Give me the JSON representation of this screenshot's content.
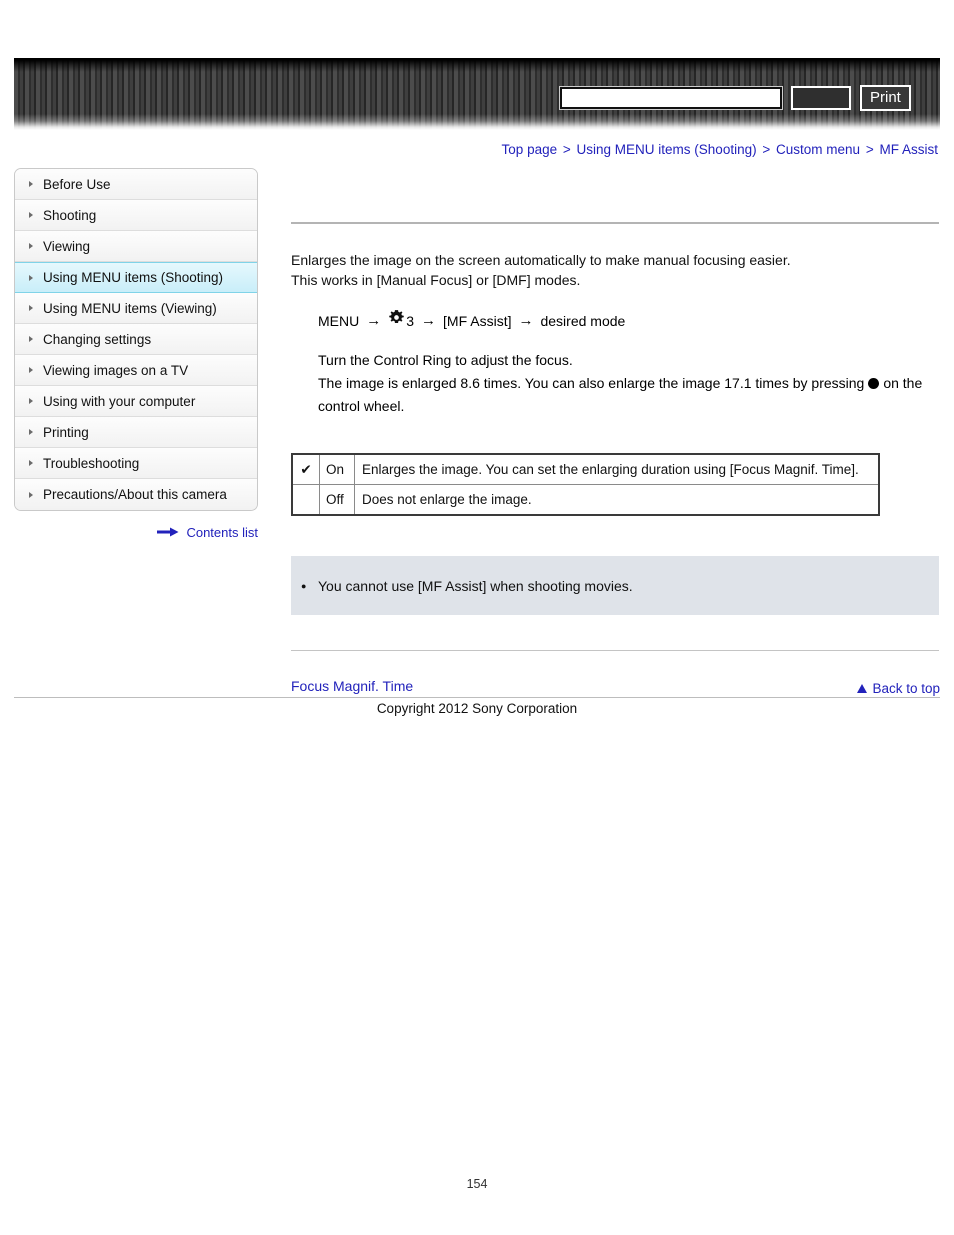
{
  "header": {
    "search_value": "",
    "search_placeholder": "",
    "search_button_label": "",
    "print_button_label": "Print"
  },
  "breadcrumb": {
    "separator": ">",
    "items": [
      {
        "label": "Top page"
      },
      {
        "label": "Using MENU items (Shooting)"
      },
      {
        "label": "Custom menu"
      },
      {
        "label": "MF Assist"
      }
    ]
  },
  "sidebar": {
    "items": [
      {
        "label": "Before Use",
        "active": false
      },
      {
        "label": "Shooting",
        "active": false
      },
      {
        "label": "Viewing",
        "active": false
      },
      {
        "label": "Using MENU items (Shooting)",
        "active": true
      },
      {
        "label": "Using MENU items (Viewing)",
        "active": false
      },
      {
        "label": "Changing settings",
        "active": false
      },
      {
        "label": "Viewing images on a TV",
        "active": false
      },
      {
        "label": "Using with your computer",
        "active": false
      },
      {
        "label": "Printing",
        "active": false
      },
      {
        "label": "Troubleshooting",
        "active": false
      },
      {
        "label": "Precautions/About this camera",
        "active": false
      }
    ],
    "contents_list_label": "Contents list"
  },
  "main": {
    "intro_line1": "Enlarges the image on the screen automatically to make manual focusing easier.",
    "intro_line2": "This works in [Manual Focus] or [DMF] modes.",
    "menu_path": {
      "menu_label": "MENU",
      "arrow": "→",
      "gear_number": "3",
      "item_label": "[MF Assist]",
      "result_label": "desired mode"
    },
    "body_line1": "Turn the Control Ring to adjust the focus.",
    "body_line2_part1": "The image is enlarged 8.6 times. You can also enlarge the image 17.1 times by pressing",
    "body_line2_part2": "on the control wheel.",
    "table": {
      "rows": [
        {
          "checked": true,
          "check_glyph": "✔",
          "option": "On",
          "description": "Enlarges the image. You can set the enlarging duration using [Focus Magnif. Time]."
        },
        {
          "checked": false,
          "check_glyph": "",
          "option": "Off",
          "description": "Does not enlarge the image."
        }
      ]
    },
    "note": {
      "items": [
        "You cannot use [MF Assist] when shooting movies."
      ]
    },
    "related_link": "Focus Magnif. Time"
  },
  "footer": {
    "back_to_top_label": "Back to top",
    "copyright": "Copyright 2012 Sony Corporation",
    "page_number": "154"
  },
  "colors": {
    "link": "#2222bb",
    "active_sidebar": "#c9eef9",
    "note_background": "#dfe3e9",
    "header_dark": "#3a3a3a"
  }
}
